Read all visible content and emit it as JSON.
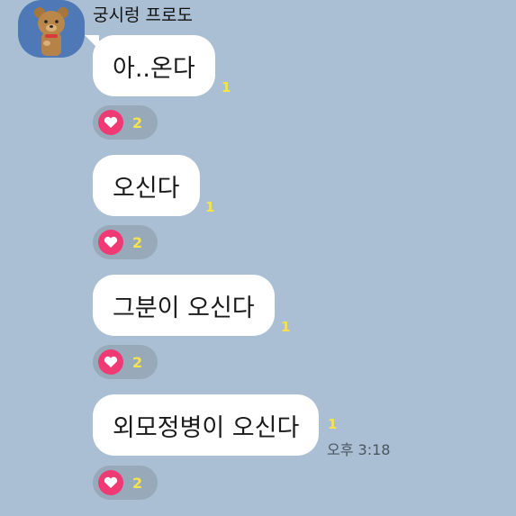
{
  "chat": {
    "sender_name": "궁시렁 프로도",
    "avatar_icon": "frodo-character-icon",
    "messages": [
      {
        "text": "아..온다",
        "unread": "1",
        "reaction_icon": "heart-icon",
        "reaction_count": "2"
      },
      {
        "text": "오신다",
        "unread": "1",
        "reaction_icon": "heart-icon",
        "reaction_count": "2"
      },
      {
        "text": "그분이 오신다",
        "unread": "1",
        "reaction_icon": "heart-icon",
        "reaction_count": "2"
      },
      {
        "text": "외모정병이 오신다",
        "unread": "1",
        "time": "오후 3:18",
        "reaction_icon": "heart-icon",
        "reaction_count": "2"
      }
    ]
  },
  "colors": {
    "background": "#aabfd3",
    "bubble": "#ffffff",
    "unread": "#f7e34a",
    "heart": "#ef3a74",
    "avatar_bg": "#4e79b6"
  }
}
